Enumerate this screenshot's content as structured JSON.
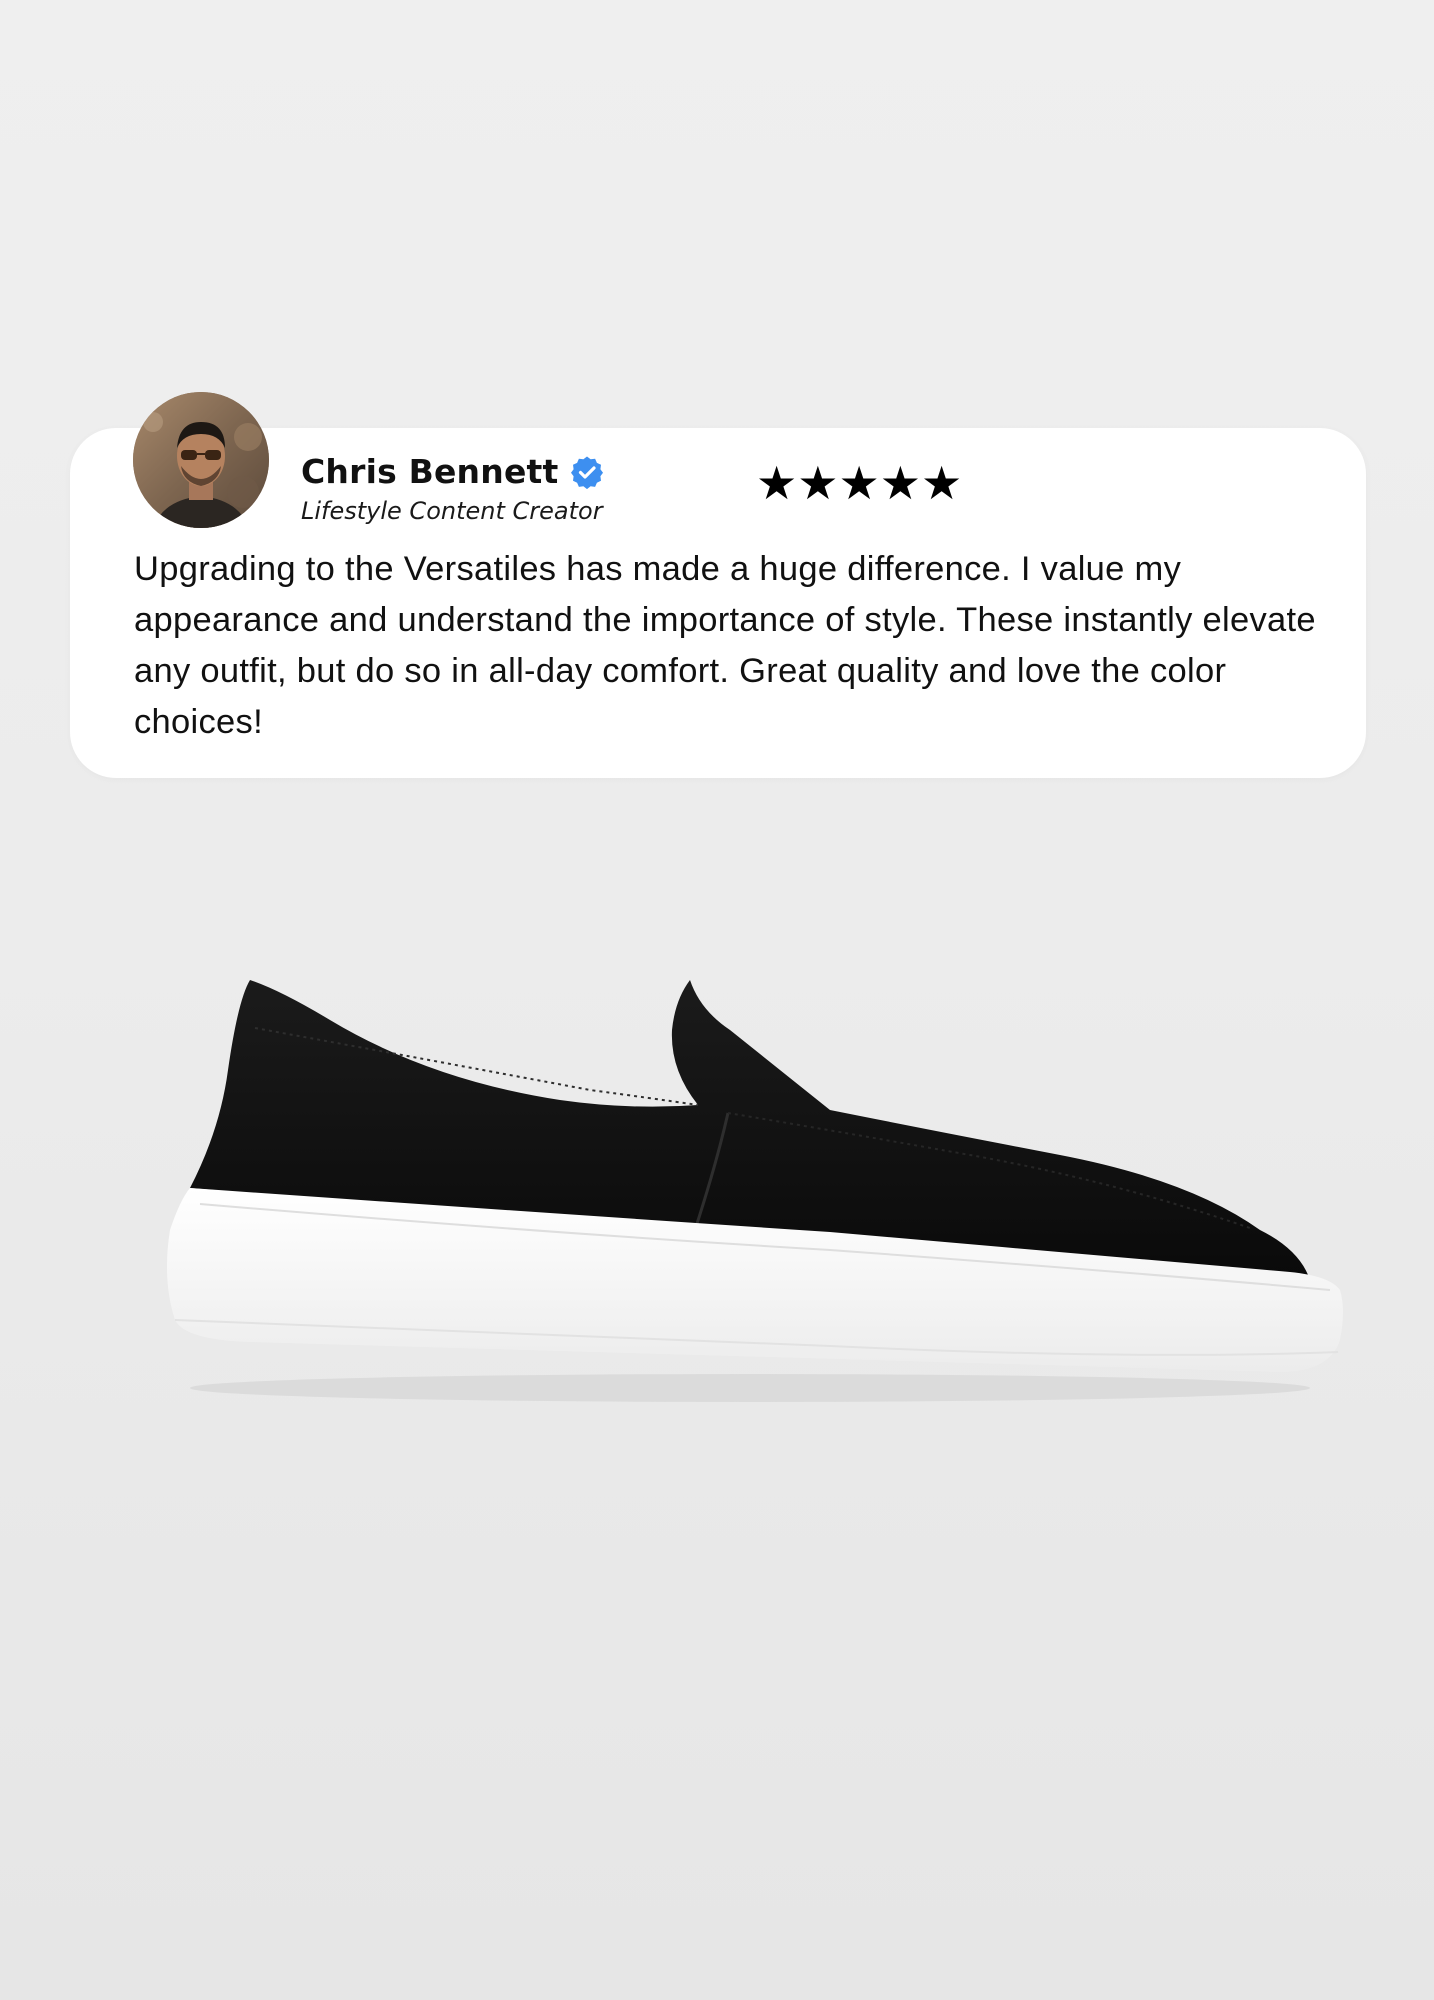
{
  "review": {
    "name": "Chris Bennett",
    "role": "Lifestyle Content Creator",
    "rating": 5,
    "stars": [
      "★",
      "★",
      "★",
      "★",
      "★"
    ],
    "text": "Upgrading to the Versatiles has made a huge difference. I value my appearance and understand the importance of style. These instantly elevate any outfit, but do so in all-day comfort. Great quality and love the color choices!"
  },
  "icons": {
    "verified": "verified-badge-icon",
    "avatar": "reviewer-avatar",
    "product": "black-slip-on-shoe-image"
  },
  "colors": {
    "background": "#ececec",
    "card": "#ffffff",
    "verified_badge": "#3d8ff0",
    "text": "#111111"
  }
}
